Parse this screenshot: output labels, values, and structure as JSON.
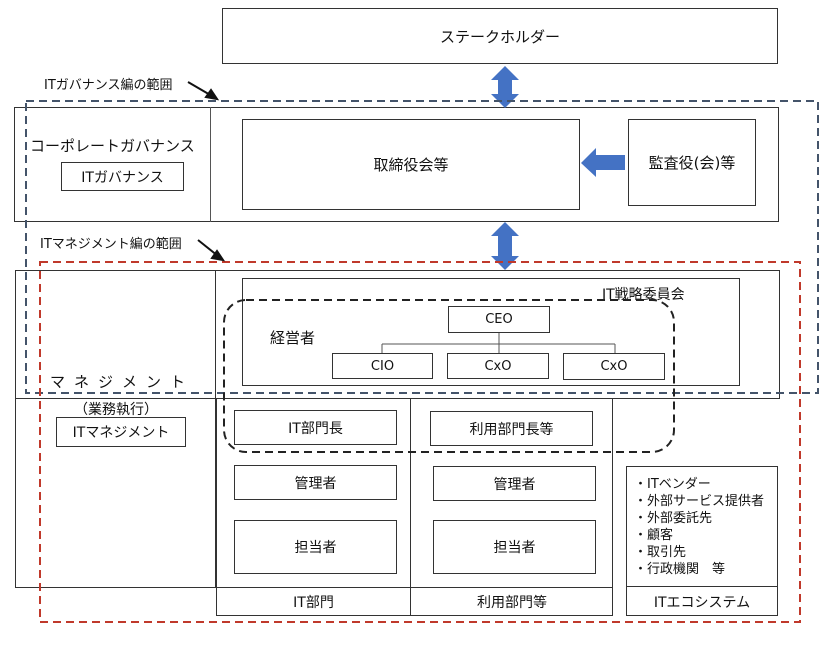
{
  "stakeholder": "ステークホルダー",
  "scope_labels": {
    "governance": "ITガバナンス編の範囲",
    "management": "ITマネジメント編の範囲"
  },
  "corporate_governance": {
    "title": "コーポレートガバナンス",
    "sub": "ITガバナンス",
    "board": "取締役会等",
    "auditor": "監査役(会)等"
  },
  "management": {
    "title": "マネジメント",
    "subtitle": "（業務執行）",
    "sub": "ITマネジメント",
    "committee": "IT戦略委員会",
    "executives_label": "経営者",
    "ceo": "CEO",
    "officers": [
      "CIO",
      "CxO",
      "CxO"
    ]
  },
  "columns": [
    {
      "footer": "IT部門",
      "head": "IT部門長",
      "manager": "管理者",
      "staff": "担当者"
    },
    {
      "footer": "利用部門等",
      "head": "利用部門長等",
      "manager": "管理者",
      "staff": "担当者"
    },
    {
      "footer": "ITエコシステム",
      "items": [
        "・ITベンダー",
        "・外部サービス提供者",
        "・外部委託先",
        "・顧客",
        "・取引先",
        "・行政機関　等"
      ]
    }
  ],
  "colors": {
    "arrow": "#4472c4",
    "governance_scope": "#44546a",
    "management_scope": "#c0392b",
    "executive_group": "#222222"
  }
}
